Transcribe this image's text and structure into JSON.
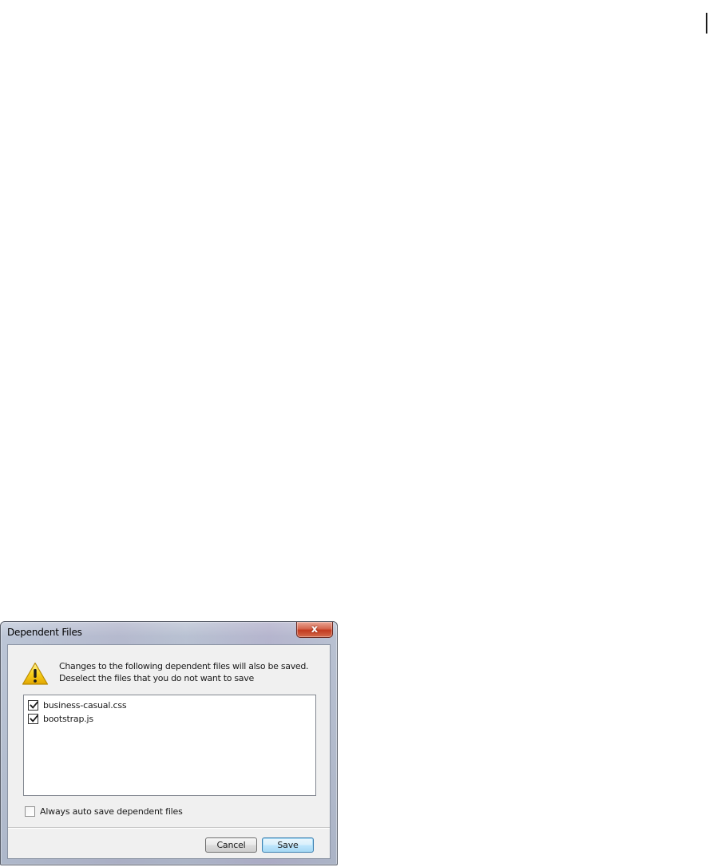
{
  "dialog": {
    "title": "Dependent Files",
    "close_label": "x",
    "message_line_1": "Changes to the following dependent files will also be saved.",
    "message_line_2": "Deselect the files that you do not want to save",
    "files": [
      {
        "name": "business-casual.css",
        "checked": true
      },
      {
        "name": "bootstrap.js",
        "checked": true
      }
    ],
    "auto_save": {
      "label": "Always auto save dependent files",
      "checked": false
    },
    "buttons": {
      "cancel": "Cancel",
      "save": "Save"
    }
  },
  "colors": {
    "warning": "#f5c400",
    "close_button": "#c23a1f",
    "default_button_border": "#3c7fb1"
  },
  "icons": {
    "warning": "warning-icon",
    "close": "close-icon",
    "check": "checkmark-icon"
  }
}
